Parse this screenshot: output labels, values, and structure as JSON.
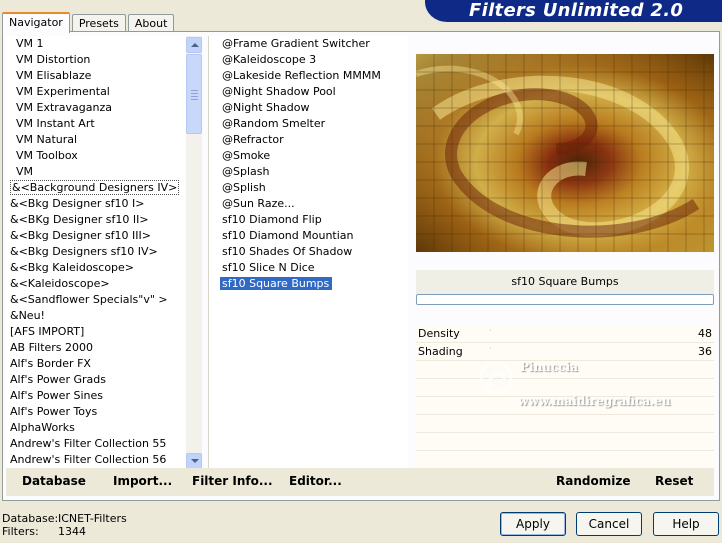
{
  "app": {
    "brand_title": "Filters Unlimited 2.0"
  },
  "tabs": [
    {
      "label": "Navigator",
      "active": true
    },
    {
      "label": "Presets",
      "active": false
    },
    {
      "label": "About",
      "active": false
    }
  ],
  "categories": [
    "VM 1",
    "VM Distortion",
    "VM Elisablaze",
    "VM Experimental",
    "VM Extravaganza",
    "VM Instant Art",
    "VM Natural",
    "VM Toolbox",
    "VM",
    "&<Background Designers IV>",
    "&<Bkg Designer sf10 I>",
    "&<BKg Designer sf10 II>",
    "&<Bkg Designer sf10 III>",
    "&<Bkg Designers sf10 IV>",
    "&<Bkg Kaleidoscope>",
    "&<Kaleidoscope>",
    "&<Sandflower Specials\"v\" >",
    "&Neu!",
    "[AFS IMPORT]",
    "AB Filters 2000",
    "Alf's Border FX",
    "Alf's Power Grads",
    "Alf's Power Sines",
    "Alf's Power Toys",
    "AlphaWorks",
    "Andrew's Filter Collection 55",
    "Andrew's Filter Collection 56"
  ],
  "selected_category": "&<Background Designers IV>",
  "filters": [
    "@Frame Gradient Switcher",
    "@Kaleidoscope 3",
    "@Lakeside Reflection MMMM",
    "@Night Shadow Pool",
    "@Night Shadow",
    "@Random Smelter",
    "@Refractor",
    "@Smoke",
    "@Splash",
    "@Splish",
    "@Sun Raze...",
    "sf10 Diamond Flip",
    "sf10 Diamond Mountian",
    "sf10 Shades Of Shadow",
    "sf10 Slice N Dice",
    "sf10 Square Bumps"
  ],
  "selected_filter": "sf10 Square Bumps",
  "preview": {
    "filter_name": "sf10 Square Bumps"
  },
  "params": [
    {
      "name": "Density",
      "value": "48"
    },
    {
      "name": "Shading",
      "value": "36"
    }
  ],
  "watermark": {
    "name": "Pinuccia",
    "url": "www.maidiregrafica.eu"
  },
  "bottom_actions": {
    "database": "Database",
    "import": "Import...",
    "filter_info": "Filter Info...",
    "editor": "Editor...",
    "randomize": "Randomize",
    "reset": "Reset"
  },
  "status": {
    "database_label": "Database:",
    "database_value": "ICNET-Filters",
    "filters_label": "Filters:",
    "filters_value": "1344"
  },
  "dialog_buttons": {
    "apply": "Apply",
    "cancel": "Cancel",
    "help": "Help"
  },
  "colors": {
    "brand_bg": "#0e2a86",
    "selection_bg": "#316ac5",
    "tab_accent": "#e68b2c"
  }
}
